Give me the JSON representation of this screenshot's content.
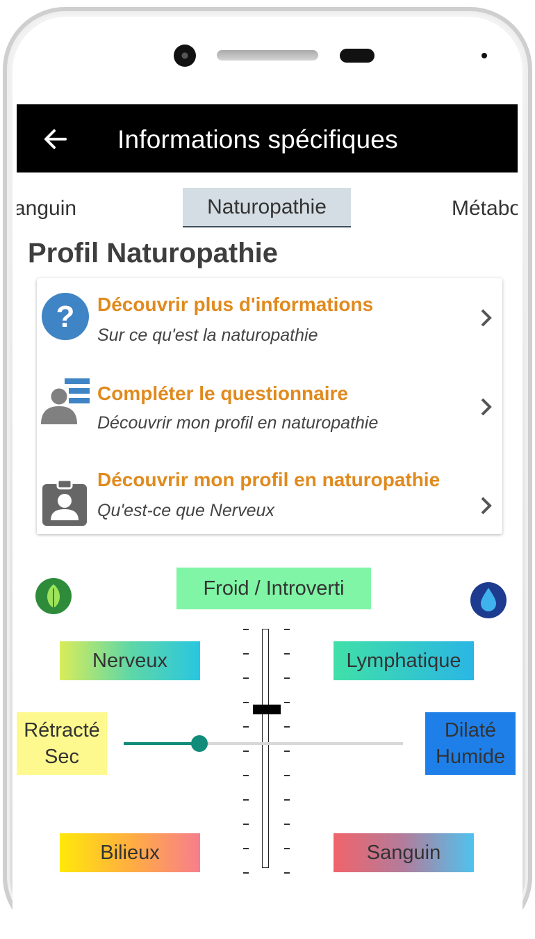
{
  "appbar": {
    "title": "Informations spécifiques"
  },
  "tabs": {
    "left": "anguin",
    "active": "Naturopathie",
    "right": "Métabo"
  },
  "section": {
    "title": "Profil Naturopathie"
  },
  "menu": [
    {
      "title": "Découvrir plus d'informations",
      "subtitle": "Sur ce qu'est la naturopathie",
      "icon": "question-icon"
    },
    {
      "title": "Compléter le questionnaire",
      "subtitle": "Découvrir mon profil en naturopathie",
      "icon": "questionnaire-person-icon"
    },
    {
      "title": "Découvrir mon profil en naturopathie",
      "subtitle": "Qu'est-ce que Nerveux",
      "icon": "badge-person-icon"
    }
  ],
  "profile_chart": {
    "top": "Froid / Introverti",
    "top_left": "Nerveux",
    "top_right": "Lymphatique",
    "left_line1": "Rétracté",
    "left_line2": "Sec",
    "right_line1": "Dilaté",
    "right_line2": "Humide",
    "bottom_left": "Bilieux",
    "bottom_right": "Sanguin",
    "vertical_level": 0.34,
    "horizontal_level": 0.27
  },
  "colors": {
    "accent_orange": "#e08a1e",
    "slider_teal": "#118c7a",
    "appbar": "#000000"
  }
}
